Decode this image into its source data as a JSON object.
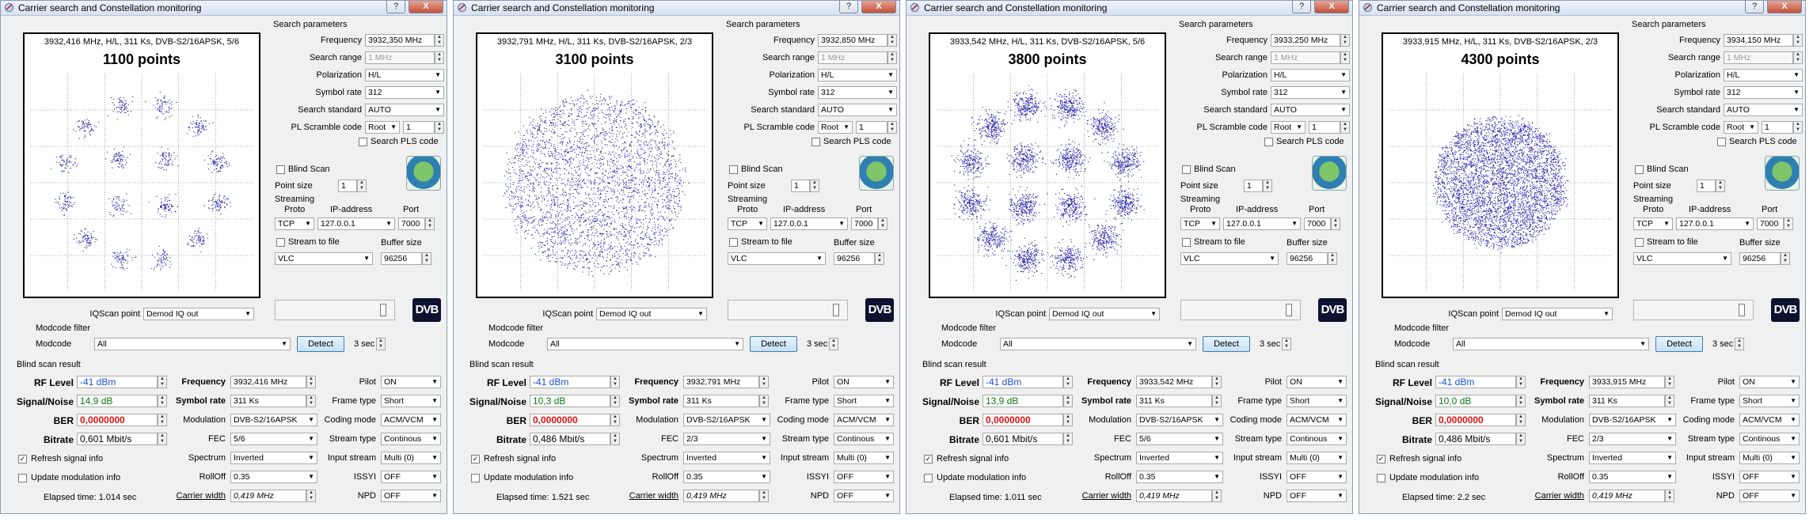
{
  "title": "Carrier search and Constellation monitoring",
  "title_buttons": {
    "help": "?",
    "close": "X"
  },
  "labels": {
    "search_params": "Search parameters",
    "frequency": "Frequency",
    "search_range": "Search range",
    "polarization": "Polarization",
    "symbol_rate": "Symbol rate",
    "search_standard": "Search standard",
    "pl_scramble": "PL Scramble code",
    "search_pls": "Search PLS code",
    "blind_scan": "Blind Scan",
    "point_size": "Point size",
    "streaming": "Streaming",
    "proto": "Proto",
    "ip_address": "IP-address",
    "port": "Port",
    "stream_to_file": "Stream to file",
    "buffer_size": "Buffer size",
    "iqscan_point": "IQScan point",
    "modcode_filter": "Modcode filter",
    "modcode": "Modcode",
    "detect": "Detect",
    "blind_result": "Blind scan result",
    "rf_level": "RF Level",
    "signal_noise": "Signal/Noise",
    "ber": "BER",
    "bitrate": "Bitrate",
    "frequency_b": "Frequency",
    "symbol_rate_b": "Symbol rate",
    "modulation": "Modulation",
    "fec": "FEC",
    "spectrum": "Spectrum",
    "rolloff": "RollOff",
    "carrier_width": "Carrier width",
    "pilot": "Pilot",
    "frame_type": "Frame type",
    "coding_mode": "Coding mode",
    "stream_type": "Stream type",
    "input_stream": "Input stream",
    "issyi": "ISSYI",
    "npd": "NPD",
    "refresh": "Refresh signal info",
    "update_mod": "Update modulation info",
    "dvb_logo": "DVB"
  },
  "windows": [
    {
      "header": "3932,416 MHz, H/L, 311 Ks, DVB-S2/16APSK, 5/6",
      "points": "1100 points",
      "point_count": 1100,
      "pattern": 0,
      "frequency": "3932,350 MHz",
      "search_range": "1 MHz",
      "polarization": "H/L",
      "symbol_rate": "312",
      "search_standard": "AUTO",
      "pl_mode": "Root",
      "pl_value": "1",
      "point_size": "1",
      "proto": "TCP",
      "ip": "127.0.0.1",
      "port": "7000",
      "player": "VLC",
      "buffer": "96256",
      "iqscan": "Demod IQ out",
      "modcode": "All",
      "detect_time": "3 sec",
      "rf": "-41 dBm",
      "snr": "14,9 dB",
      "ber": "0,0000000",
      "bitrate": "0,601 Mbit/s",
      "freq_result": "3932,416 MHz",
      "sr_result": "311 Ks",
      "modulation": "DVB-S2/16APSK",
      "fec": "5/6",
      "spectrum": "Inverted",
      "rolloff": "0.35",
      "carrier_width": "0,419 MHz",
      "pilot": "ON",
      "frame_type": "Short",
      "coding_mode": "ACM/VCM",
      "stream_type": "Continous",
      "input_stream": "Multi (0)",
      "issyi": "OFF",
      "npd": "OFF",
      "elapsed": "Elapsed time: 1.014 sec"
    },
    {
      "header": "3932,791 MHz, H/L, 311 Ks, DVB-S2/16APSK, 2/3",
      "points": "3100 points",
      "point_count": 3100,
      "pattern": 1,
      "frequency": "3932,850 MHz",
      "search_range": "1 MHz",
      "polarization": "H/L",
      "symbol_rate": "312",
      "search_standard": "AUTO",
      "pl_mode": "Root",
      "pl_value": "1",
      "point_size": "1",
      "proto": "TCP",
      "ip": "127.0.0.1",
      "port": "7000",
      "player": "VLC",
      "buffer": "96256",
      "iqscan": "Demod IQ out",
      "modcode": "All",
      "detect_time": "3 sec",
      "rf": "-41 dBm",
      "snr": "10,3 dB",
      "ber": "0,0000000",
      "bitrate": "0,486 Mbit/s",
      "freq_result": "3932,791 MHz",
      "sr_result": "311 Ks",
      "modulation": "DVB-S2/16APSK",
      "fec": "2/3",
      "spectrum": "Inverted",
      "rolloff": "0.35",
      "carrier_width": "0,419 MHz",
      "pilot": "ON",
      "frame_type": "Short",
      "coding_mode": "ACM/VCM",
      "stream_type": "Continous",
      "input_stream": "Multi (0)",
      "issyi": "OFF",
      "npd": "OFF",
      "elapsed": "Elapsed time: 1.521 sec"
    },
    {
      "header": "3933,542 MHz, H/L, 311 Ks, DVB-S2/16APSK, 5/6",
      "points": "3800 points",
      "point_count": 3800,
      "pattern": 0,
      "frequency": "3933,250 MHz",
      "search_range": "1 MHz",
      "polarization": "H/L",
      "symbol_rate": "312",
      "search_standard": "AUTO",
      "pl_mode": "Root",
      "pl_value": "1",
      "point_size": "1",
      "proto": "TCP",
      "ip": "127.0.0.1",
      "port": "7000",
      "player": "VLC",
      "buffer": "96256",
      "iqscan": "Demod IQ out",
      "modcode": "All",
      "detect_time": "3 sec",
      "rf": "-41 dBm",
      "snr": "13,9 dB",
      "ber": "0,0000000",
      "bitrate": "0,601 Mbit/s",
      "freq_result": "3933,542 MHz",
      "sr_result": "311 Ks",
      "modulation": "DVB-S2/16APSK",
      "fec": "5/6",
      "spectrum": "Inverted",
      "rolloff": "0.35",
      "carrier_width": "0,419 MHz",
      "pilot": "ON",
      "frame_type": "Short",
      "coding_mode": "ACM/VCM",
      "stream_type": "Continous",
      "input_stream": "Multi (0)",
      "issyi": "OFF",
      "npd": "OFF",
      "elapsed": "Elapsed time: 1.011 sec"
    },
    {
      "header": "3933,915 MHz, H/L, 311 Ks, DVB-S2/16APSK, 2/3",
      "points": "4300 points",
      "point_count": 4300,
      "pattern": 2,
      "frequency": "3934,150 MHz",
      "search_range": "1 MHz",
      "polarization": "H/L",
      "symbol_rate": "312",
      "search_standard": "AUTO",
      "pl_mode": "Root",
      "pl_value": "1",
      "point_size": "1",
      "proto": "TCP",
      "ip": "127.0.0.1",
      "port": "7000",
      "player": "VLC",
      "buffer": "96256",
      "iqscan": "Demod IQ out",
      "modcode": "All",
      "detect_time": "3 sec",
      "rf": "-41 dBm",
      "snr": "10,0 dB",
      "ber": "0,0000000",
      "bitrate": "0,486 Mbit/s",
      "freq_result": "3933,915 MHz",
      "sr_result": "311 Ks",
      "modulation": "DVB-S2/16APSK",
      "fec": "2/3",
      "spectrum": "Inverted",
      "rolloff": "0.35",
      "carrier_width": "0,419 MHz",
      "pilot": "ON",
      "frame_type": "Short",
      "coding_mode": "ACM/VCM",
      "stream_type": "Continous",
      "input_stream": "Multi (0)",
      "issyi": "OFF",
      "npd": "OFF",
      "elapsed": "Elapsed time: 2.2 sec"
    }
  ],
  "colors": {
    "rf": "#1a4fd6",
    "snr": "#0d7a12",
    "ber": "#e01010",
    "points": "#1a1aa8",
    "grid": "#888888"
  }
}
